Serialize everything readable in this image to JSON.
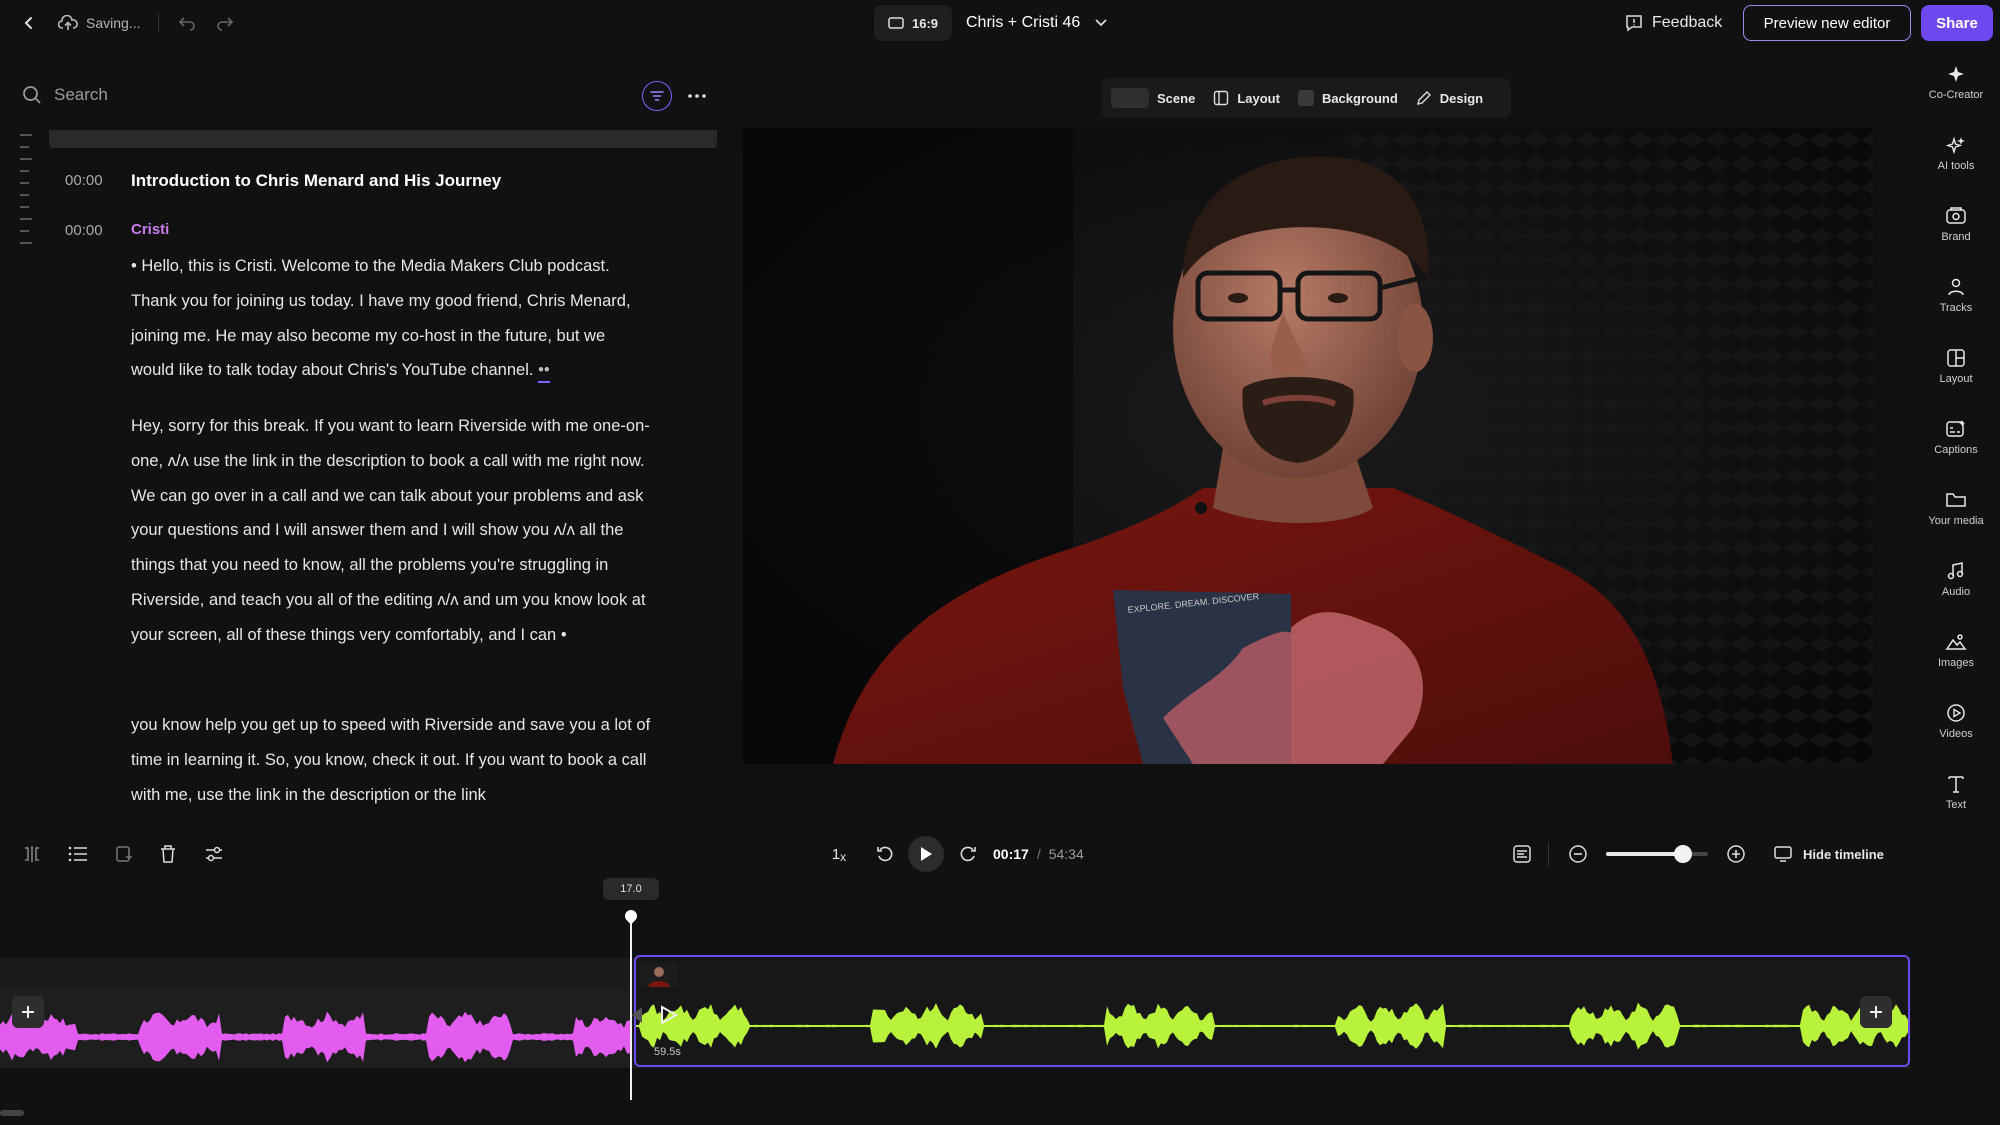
{
  "topbar": {
    "saving": "Saving...",
    "aspect_ratio": "16:9",
    "project_title": "Chris + Cristi 46",
    "feedback": "Feedback",
    "preview_new_editor": "Preview new editor",
    "share": "Share"
  },
  "transcript": {
    "search_placeholder": "Search",
    "chapter": {
      "time": "00:00",
      "title": "Introduction to Chris Menard and His Journey"
    },
    "speaker": {
      "time": "00:00",
      "name": "Cristi"
    },
    "paragraphs": {
      "p1_prefix": "• ",
      "p1": "Hello, this is Cristi. Welcome to the Media Makers Club podcast. Thank you for joining us today. I have my good friend, Chris Menard, joining me. He may also become my co-host in the future, but we would like to talk today about Chris's YouTube channel.",
      "p1_suffix": "••",
      "p2": "Hey, sorry for this break. If you want to learn Riverside with me one-on-one, ʌ/ʌ use the link in the description to book a call with me right now. We can go over in a call and we can talk about your problems and ask your questions and I will answer them and I will show you ʌ/ʌ all the things that you need to know, all the problems you're struggling in Riverside, and teach you all of the editing ʌ/ʌ and um you know look at your screen, all of these things very comfortably, and I can •",
      "p3": "you know help you get up to speed with Riverside and save you a lot of time in learning it. So, you know, check it out. If you want to book a call with me, use the link in the description or the link"
    }
  },
  "scene_toolbar": {
    "scene": "Scene",
    "layout": "Layout",
    "background": "Background",
    "design": "Design"
  },
  "video_frame": {
    "shirt_text": "EXPLORE. DREAM. DISCOVER"
  },
  "right_rail": [
    {
      "label": "Co-Creator",
      "icon": "sparkle-icon"
    },
    {
      "label": "AI tools",
      "icon": "ai-sparkles-icon"
    },
    {
      "label": "Brand",
      "icon": "brand-icon"
    },
    {
      "label": "Tracks",
      "icon": "tracks-icon"
    },
    {
      "label": "Layout",
      "icon": "layout-icon"
    },
    {
      "label": "Captions",
      "icon": "captions-icon"
    },
    {
      "label": "Your media",
      "icon": "folder-icon"
    },
    {
      "label": "Audio",
      "icon": "music-note-icon"
    },
    {
      "label": "Images",
      "icon": "image-icon"
    },
    {
      "label": "Videos",
      "icon": "video-play-icon"
    },
    {
      "label": "Text",
      "icon": "text-icon"
    }
  ],
  "controls": {
    "speed": "1",
    "speed_unit": "x",
    "current_time": "00:17",
    "separator": "/",
    "total_time": "54:34",
    "hide_timeline": "Hide timeline",
    "zoom_level": 0.75
  },
  "timeline": {
    "playhead": "17.0",
    "clip_duration": "59.5s"
  },
  "colors": {
    "accent": "#6e49f2",
    "speaker": "#c97cf0",
    "waveform_a": "#e25cf0",
    "waveform_b": "#b9f23a"
  }
}
